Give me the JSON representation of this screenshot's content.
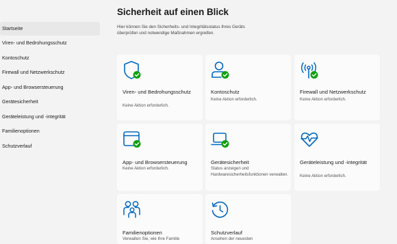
{
  "colors": {
    "accent": "#0067c0",
    "ok": "#12a10e",
    "window_bg": "#f3f3f3",
    "tile_bg": "#fbfbfb"
  },
  "sidebar": {
    "items": [
      {
        "label": "Startseite",
        "active": true
      },
      {
        "label": "Viren- und Bedrohungsschutz"
      },
      {
        "label": "Kontoschutz"
      },
      {
        "label": "Firewall und Netzwerkschutz"
      },
      {
        "label": "App- und Browsersteuerung"
      },
      {
        "label": "Gerätesicherheit"
      },
      {
        "label": "Geräteleistung und -integrität"
      },
      {
        "label": "Familienoptionen"
      },
      {
        "label": "Schutzverlauf"
      }
    ]
  },
  "main": {
    "title": "Sicherheit auf einen Blick",
    "description": "Hier können Sie den Sicherheits- und Integritätsstatus Ihres Geräts überprüfen und notwendige Maßnahmen ergreifen.",
    "tiles": [
      {
        "icon": "shield-icon",
        "title": "Viren- und Bedrohungsschutz",
        "subtitle": "Keine Aktion erforderlich."
      },
      {
        "icon": "person-icon",
        "title": "Kontoschutz",
        "subtitle": "Keine Aktion erforderlich."
      },
      {
        "icon": "wifi-antenna-icon",
        "title": "Firewall und Netzwerkschutz",
        "subtitle": "Keine Aktion erforderlich."
      },
      {
        "icon": "browser-window-icon",
        "title": "App- und Browsersteuerung",
        "subtitle": "Keine Aktion erforderlich."
      },
      {
        "icon": "laptop-icon",
        "title": "Gerätesicherheit",
        "subtitle": "Status anzeigen und Hardwaresicherheitsfunktionen verwalten."
      },
      {
        "icon": "heart-pulse-icon",
        "title": "Geräteleistung und -integrität",
        "subtitle": "Keine Aktion erforderlich."
      },
      {
        "icon": "family-icon",
        "title": "Familienoptionen",
        "subtitle": "Verwalten Sie, wie Ihre Familie"
      },
      {
        "icon": "history-clock-icon",
        "title": "Schutzverlauf",
        "subtitle": "Ansehen der neuesten"
      }
    ]
  }
}
